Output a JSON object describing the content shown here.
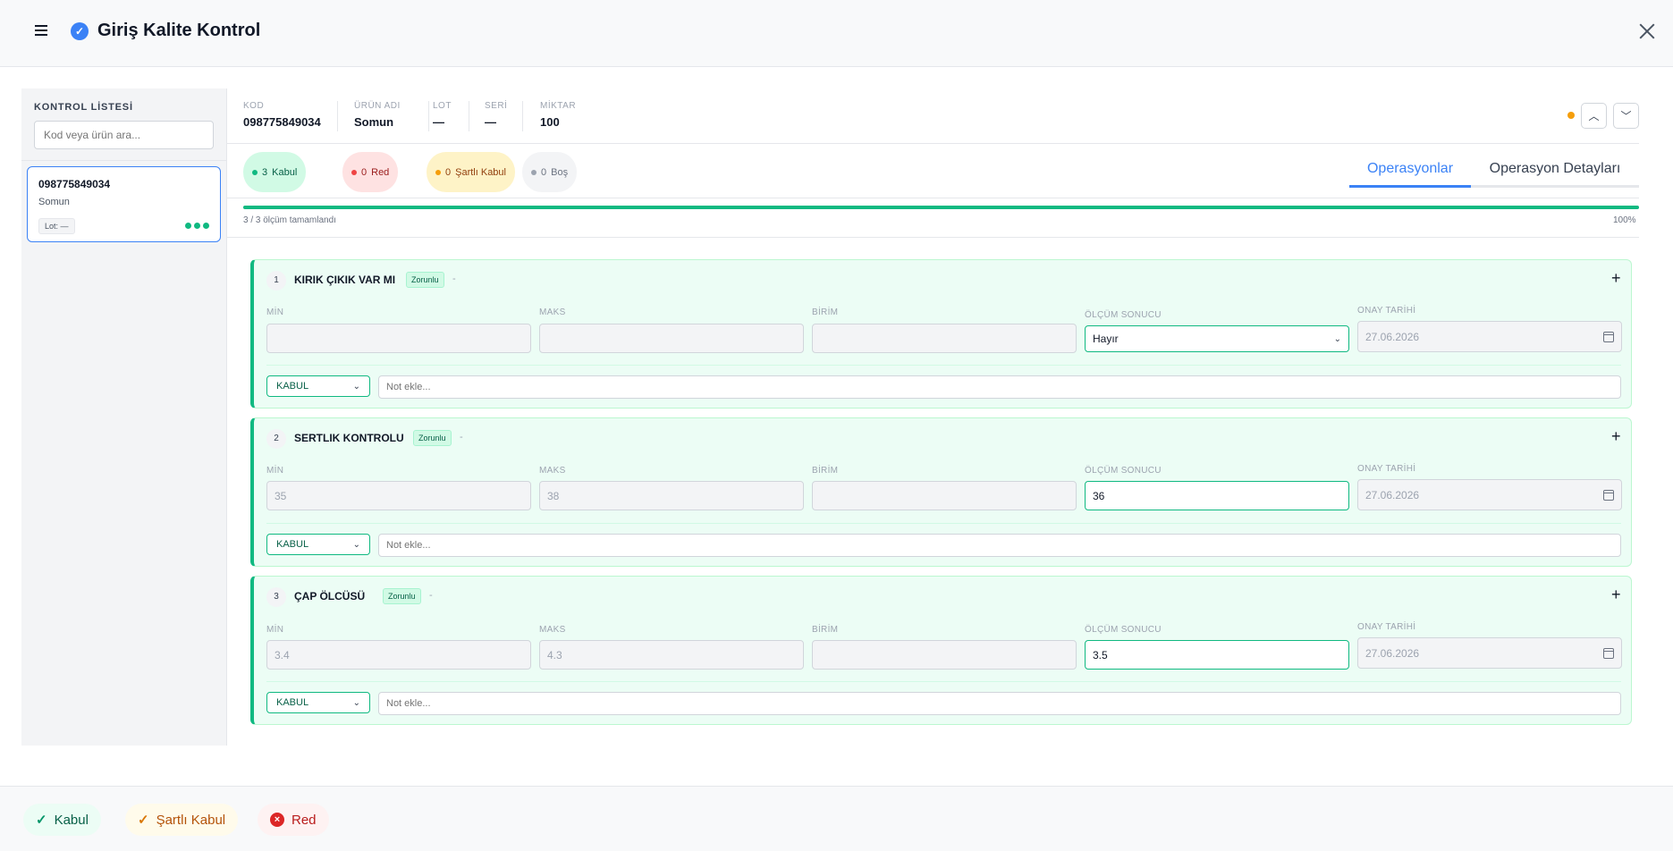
{
  "header": {
    "title": "Giriş Kalite Kontrol"
  },
  "sidebar": {
    "title": "KONTROL LİSTESİ",
    "search_placeholder": "Kod veya ürün ara...",
    "items": [
      {
        "code": "098775849034",
        "name": "Somun",
        "lot": "Lot: —"
      }
    ]
  },
  "info": {
    "fields": [
      {
        "label": "KOD",
        "value": "098775849034"
      },
      {
        "label": "ÜRÜN ADI",
        "value": "Somun"
      },
      {
        "label": "LOT",
        "value": "—"
      },
      {
        "label": "SERİ",
        "value": "—"
      },
      {
        "label": "MİKTAR",
        "value": "100"
      }
    ],
    "status_color": "#f59e0b"
  },
  "stats": {
    "kabul": {
      "count": "3",
      "label": "Kabul",
      "color": "#10b981"
    },
    "red": {
      "count": "0",
      "label": "Red",
      "color": "#ef4444"
    },
    "sartli": {
      "count": "0",
      "label": "Şartlı Kabul",
      "color": "#f59e0b"
    },
    "bos": {
      "count": "0",
      "label": "Boş",
      "color": "#9ca3af"
    }
  },
  "tabs": [
    {
      "label": "Operasyonlar",
      "active": true
    },
    {
      "label": "Operasyon Detayları",
      "active": false
    }
  ],
  "progress": {
    "text": "3 / 3 ölçüm tamamlandı",
    "percent_label": "100%",
    "fraction": 1.0
  },
  "field_labels": {
    "min": "MİN",
    "maks": "MAKS",
    "birim": "BİRİM",
    "sonuc": "ÖLÇÜM SONUCU",
    "tarih": "ONAY TARİHİ"
  },
  "operations": [
    {
      "num": "1",
      "name": "KIRIK ÇIKIK VAR MI",
      "tag": "Zorunlu",
      "dash": "-",
      "min": "",
      "maks": "",
      "birim": "",
      "sonuc": "Hayır",
      "sonuc_is_select": true,
      "tarih": "27.06.2026",
      "decision": "KABUL",
      "note_placeholder": "Not ekle..."
    },
    {
      "num": "2",
      "name": "SERTLIK KONTROLU",
      "tag": "Zorunlu",
      "dash": "-",
      "min": "35",
      "maks": "38",
      "birim": "",
      "sonuc": "36",
      "sonuc_is_select": false,
      "tarih": "27.06.2026",
      "decision": "KABUL",
      "note_placeholder": "Not ekle..."
    },
    {
      "num": "3",
      "name": "ÇAP ÖLCÜSÜ",
      "tag": "Zorunlu",
      "dash": "-",
      "min": "3.4",
      "maks": "4.3",
      "birim": "",
      "sonuc": "3.5",
      "sonuc_is_select": false,
      "tarih": "27.06.2026",
      "decision": "KABUL",
      "note_placeholder": "Not ekle..."
    }
  ],
  "footer": {
    "kabul_label": "Kabul",
    "sartli_label": "Şartlı Kabul",
    "red_label": "Red"
  }
}
